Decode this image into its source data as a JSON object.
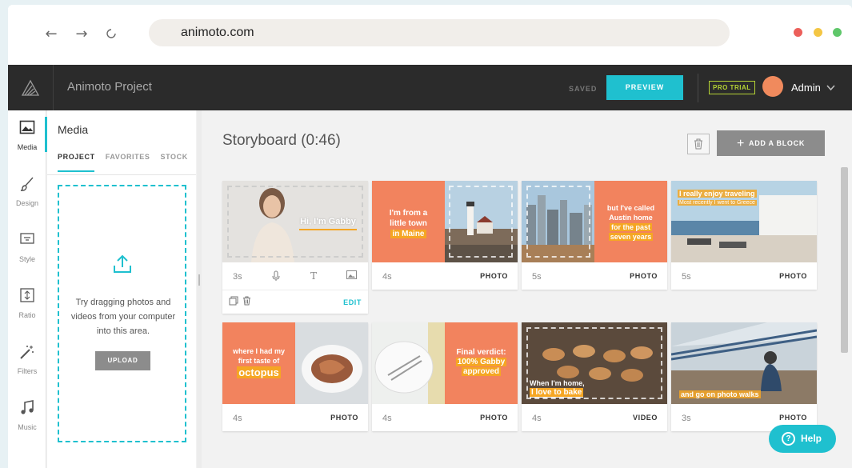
{
  "browser": {
    "url": "animoto.com",
    "back_icon": "arrow-left",
    "forward_icon": "arrow-right",
    "reload_icon": "reload",
    "dots": [
      "#ec5f5a",
      "#f4c644",
      "#5fc76a"
    ]
  },
  "topbar": {
    "project_title": "Animoto Project",
    "saved_label": "SAVED",
    "preview_label": "PREVIEW",
    "pro_badge": "PRO TRIAL",
    "user_name": "Admin",
    "accent": "#1fc0cf"
  },
  "rail": {
    "items": [
      {
        "label": "Media",
        "icon": "image-icon"
      },
      {
        "label": "Design",
        "icon": "brush-icon"
      },
      {
        "label": "Style",
        "icon": "style-icon"
      },
      {
        "label": "Ratio",
        "icon": "ratio-icon"
      },
      {
        "label": "Filters",
        "icon": "wand-icon"
      },
      {
        "label": "Music",
        "icon": "music-icon"
      }
    ]
  },
  "media": {
    "title": "Media",
    "tabs": [
      "PROJECT",
      "FAVORITES",
      "STOCK"
    ],
    "drop_text": "Try dragging photos and videos from your computer into this area.",
    "upload_label": "UPLOAD"
  },
  "storyboard": {
    "title": "Storyboard (0:46)",
    "add_block_label": "ADD A BLOCK",
    "edit_label": "EDIT",
    "cards": [
      {
        "duration": "3s",
        "type": "",
        "overlay": "Hi, I'm Gabby"
      },
      {
        "duration": "4s",
        "type": "PHOTO",
        "overlay_lines": [
          "I'm from a",
          "little town",
          "in Maine"
        ]
      },
      {
        "duration": "5s",
        "type": "PHOTO",
        "overlay_lines": [
          "but I've called",
          "Austin home",
          "for the past",
          "seven years"
        ]
      },
      {
        "duration": "5s",
        "type": "PHOTO",
        "overlay_lines": [
          "I really enjoy traveling",
          "Most recently I went to Greece"
        ]
      },
      {
        "duration": "4s",
        "type": "PHOTO",
        "overlay_lines": [
          "where I had my",
          "first taste of",
          "octopus"
        ]
      },
      {
        "duration": "4s",
        "type": "PHOTO",
        "overlay_lines": [
          "Final verdict:",
          "100% Gabby",
          "approved"
        ]
      },
      {
        "duration": "4s",
        "type": "VIDEO",
        "overlay_lines": [
          "When I'm home,",
          "I love to bake"
        ]
      },
      {
        "duration": "3s",
        "type": "PHOTO",
        "overlay_lines": [
          "and go on photo walks"
        ]
      }
    ]
  },
  "help_label": "Help"
}
